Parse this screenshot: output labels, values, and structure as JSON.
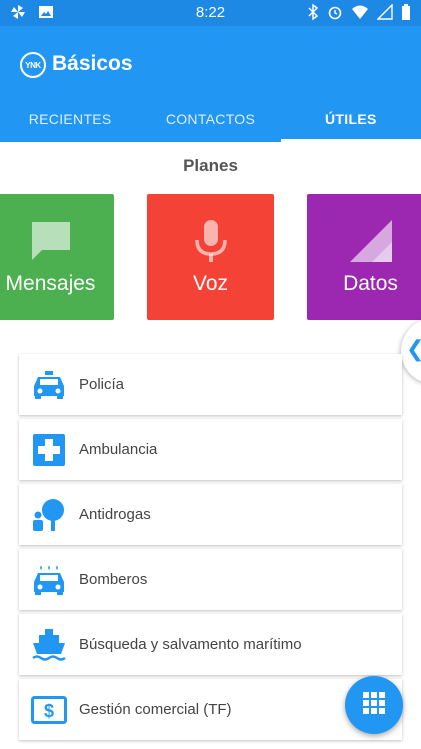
{
  "status_bar": {
    "time": "8:22",
    "left_icons": [
      "pinwheel-icon",
      "image-icon"
    ],
    "right_icons": [
      "bluetooth-icon",
      "alarm-icon",
      "wifi-icon",
      "signal-icon",
      "battery-icon"
    ]
  },
  "app_bar": {
    "logo_text": "YNK",
    "title": "Básicos",
    "background": "#2196f3"
  },
  "tabs": [
    {
      "label": "RECIENTES",
      "active": false
    },
    {
      "label": "CONTACTOS",
      "active": false
    },
    {
      "label": "ÚTILES",
      "active": true
    }
  ],
  "plans": {
    "title": "Planes",
    "items": [
      {
        "label": "Mensajes",
        "icon": "message-icon",
        "color": "#4caf50"
      },
      {
        "label": "Voz",
        "icon": "microphone-icon",
        "color": "#f44336"
      },
      {
        "label": "Datos",
        "icon": "signal-triangle-icon",
        "color": "#9c27b0"
      }
    ]
  },
  "services": [
    {
      "label": "Policía",
      "icon": "police-car-icon"
    },
    {
      "label": "Ambulancia",
      "icon": "medical-cross-icon"
    },
    {
      "label": "Antidrogas",
      "icon": "person-tree-icon"
    },
    {
      "label": "Bomberos",
      "icon": "fire-truck-icon"
    },
    {
      "label": "Búsqueda y salvamento marítimo",
      "icon": "ship-icon"
    },
    {
      "label": "Gestión comercial (TF)",
      "icon": "dollar-icon"
    }
  ],
  "accent_color": "#2196f3",
  "fab_icon": "grid-dialpad-icon"
}
